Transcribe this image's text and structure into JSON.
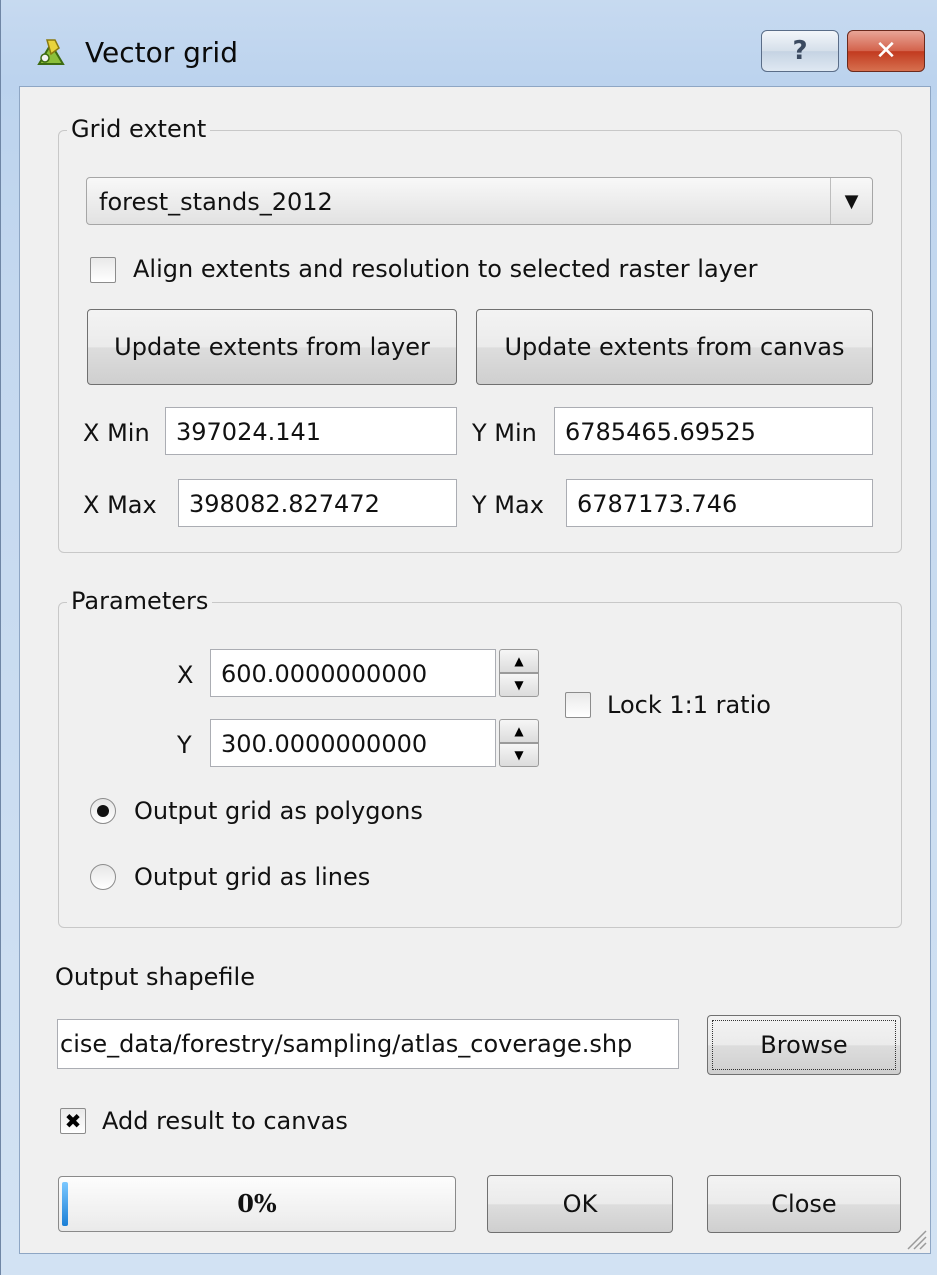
{
  "window": {
    "title": "Vector grid",
    "help_label": "?",
    "close_label": "✕"
  },
  "grid_extent": {
    "legend": "Grid extent",
    "layer_selected": "forest_stands_2012",
    "align_checkbox_label": "Align extents and resolution to selected raster layer",
    "align_checked": false,
    "update_from_layer_label": "Update extents from layer",
    "update_from_canvas_label": "Update extents from canvas",
    "xmin_label": "X Min",
    "xmin_value": "397024.141",
    "ymin_label": "Y Min",
    "ymin_value": "6785465.69525",
    "xmax_label": "X Max",
    "xmax_value": "398082.827472",
    "ymax_label": "Y Max",
    "ymax_value": "6787173.746"
  },
  "parameters": {
    "legend": "Parameters",
    "x_label": "X",
    "x_value": "600.0000000000",
    "y_label": "Y",
    "y_value": "300.0000000000",
    "lock_ratio_label": "Lock 1:1 ratio",
    "lock_ratio_checked": false,
    "radio_polygons_label": "Output grid as polygons",
    "radio_lines_label": "Output grid as lines",
    "selected_output": "polygons"
  },
  "output": {
    "label": "Output shapefile",
    "path_value": "cise_data/forestry/sampling/atlas_coverage.shp",
    "browse_label": "Browse",
    "add_to_canvas_label": "Add result to canvas",
    "add_to_canvas_checked": true
  },
  "footer": {
    "progress_text": "0%",
    "progress_fraction": 0.0,
    "ok_label": "OK",
    "close_label": "Close"
  },
  "colors": {
    "frame": "#bcd3ee",
    "client_bg": "#f0f0f0",
    "close_button": "#c23a1f",
    "progress_fill": "#1b7fd6"
  },
  "icons": {
    "app": "qgis-logo-icon",
    "dropdown": "chevron-down-icon",
    "spin_up": "arrow-up-icon",
    "spin_down": "arrow-down-icon",
    "checked": "checkmark-x-icon",
    "grip": "resize-grip-icon"
  }
}
